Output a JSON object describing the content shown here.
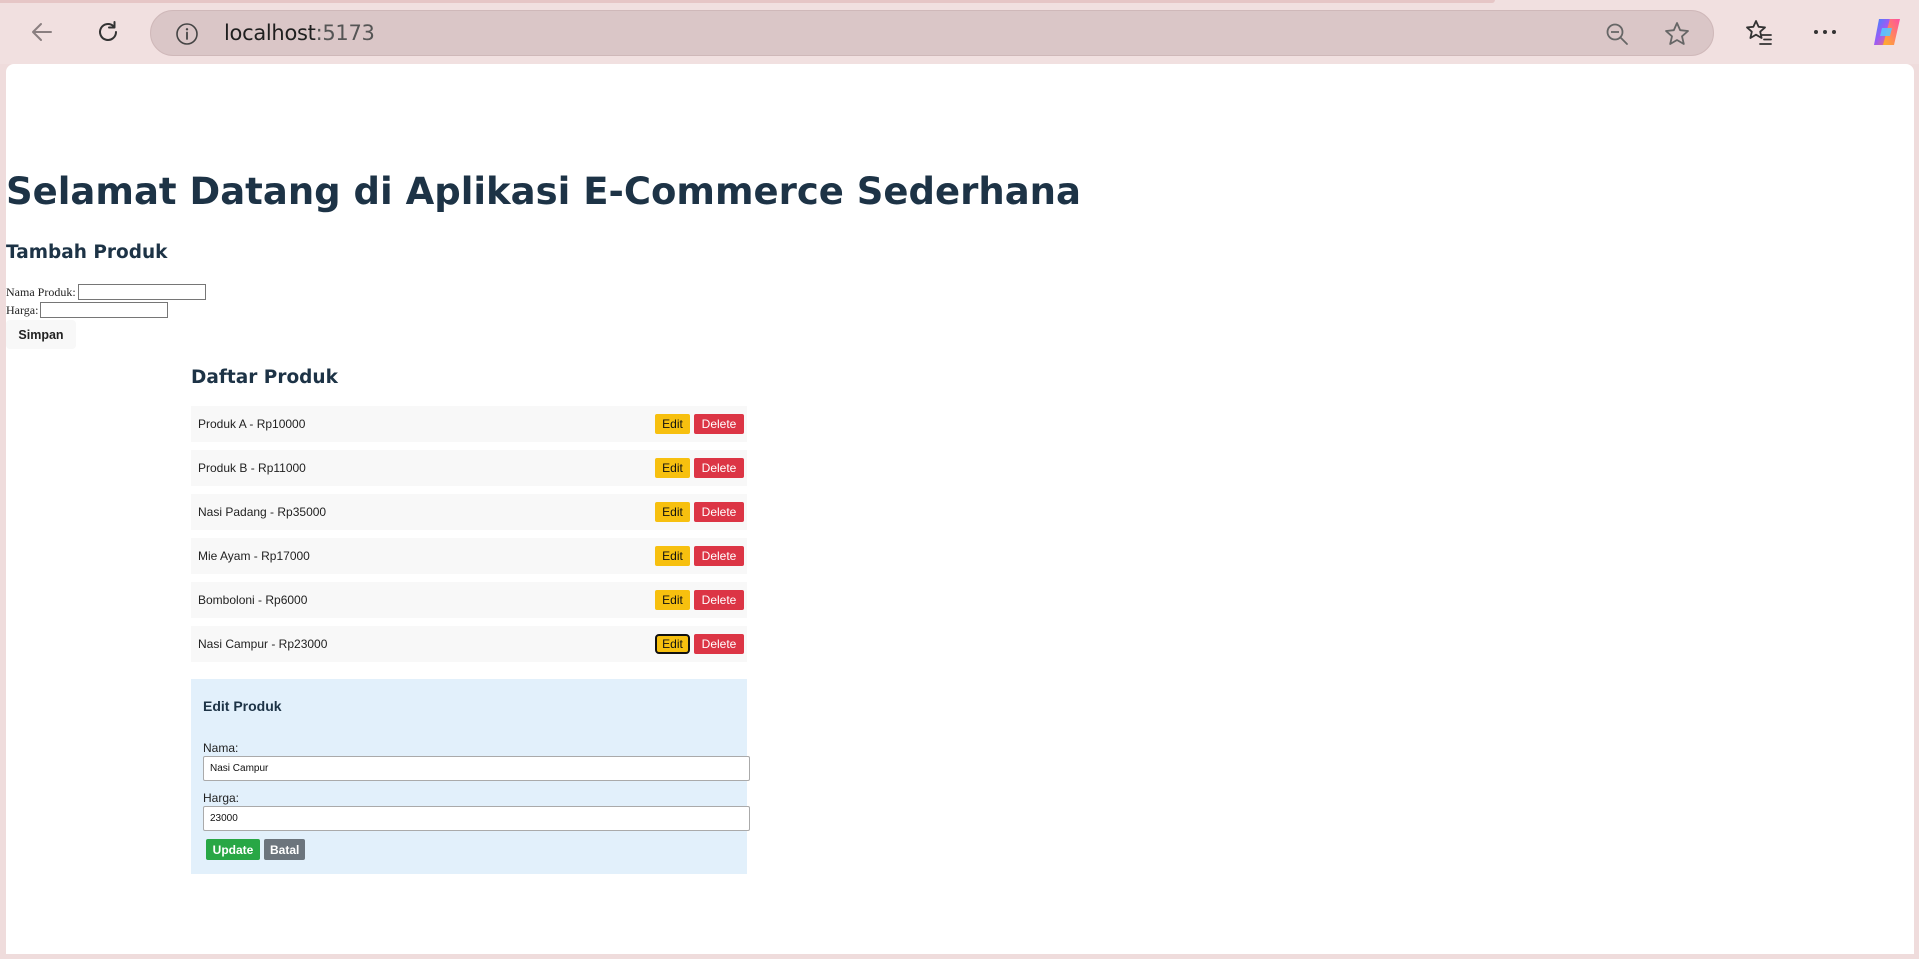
{
  "browser": {
    "url_host": "localhost",
    "url_port": ":5173"
  },
  "page": {
    "title": "Selamat Datang di Aplikasi E-Commerce Sederhana",
    "add_form": {
      "heading": "Tambah Produk",
      "name_label": "Nama Produk:",
      "name_value": "",
      "price_label": "Harga:",
      "price_value": "",
      "submit_label": "Simpan"
    },
    "list": {
      "heading": "Daftar Produk",
      "edit_label": "Edit",
      "delete_label": "Delete",
      "items": [
        {
          "text": "Produk A - Rp10000"
        },
        {
          "text": "Produk B - Rp11000"
        },
        {
          "text": "Nasi Padang - Rp35000"
        },
        {
          "text": "Mie Ayam - Rp17000"
        },
        {
          "text": "Bomboloni - Rp6000"
        },
        {
          "text": "Nasi Campur - Rp23000"
        }
      ]
    },
    "edit_panel": {
      "heading": "Edit Produk",
      "name_label": "Nama:",
      "name_value": "Nasi Campur",
      "price_label": "Harga:",
      "price_value": "23000",
      "update_label": "Update",
      "cancel_label": "Batal"
    }
  },
  "colors": {
    "edit_button": "#f7c00f",
    "delete_button": "#dc3545",
    "update_button": "#28a745",
    "cancel_button": "#6c757d",
    "edit_panel_bg": "#e2f0fb",
    "heading": "#1d3346"
  }
}
